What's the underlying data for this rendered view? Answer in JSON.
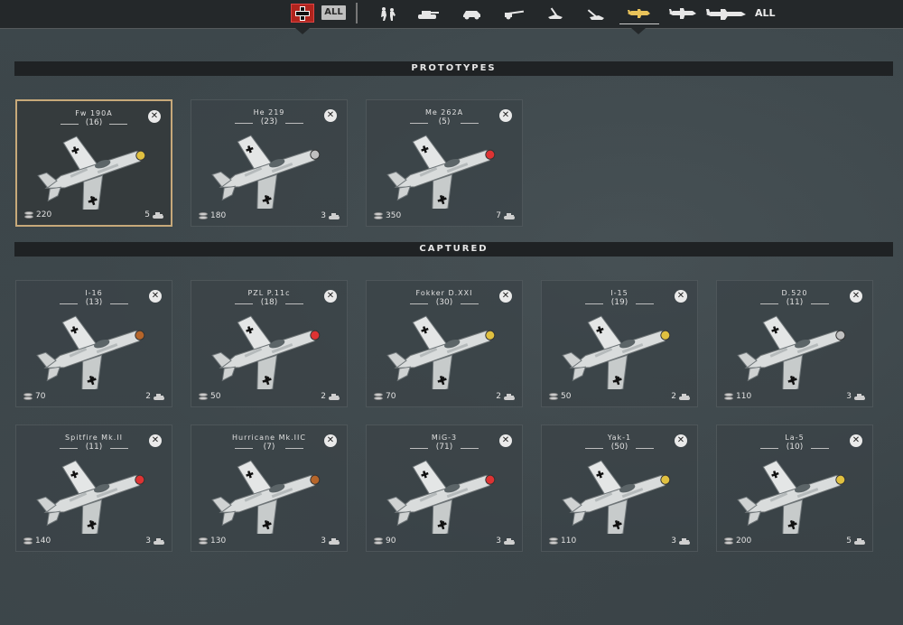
{
  "topbar": {
    "nation_icon": "german-cross-icon",
    "all_small_label": "ALL",
    "all_label": "ALL",
    "categories": [
      {
        "icon": "infantry-icon"
      },
      {
        "icon": "tank-icon"
      },
      {
        "icon": "armored-car-icon"
      },
      {
        "icon": "artillery-icon"
      },
      {
        "icon": "anti-tank-gun-icon"
      },
      {
        "icon": "anti-air-gun-icon"
      },
      {
        "icon": "fighter-plane-icon"
      },
      {
        "icon": "bomber-plane-icon"
      },
      {
        "icon": "heavy-bomber-icon"
      }
    ]
  },
  "sections": {
    "prototypes": "PROTOTYPES",
    "captured": "CAPTURED"
  },
  "prototypes": [
    {
      "name": "Fw 190A",
      "count": "(16)",
      "cost": "220",
      "requirement": "5",
      "selected": true
    },
    {
      "name": "He 219",
      "count": "(23)",
      "cost": "180",
      "requirement": "3"
    },
    {
      "name": "Me 262A",
      "count": "(5)",
      "cost": "350",
      "requirement": "7"
    }
  ],
  "captured_row1": [
    {
      "name": "I-16",
      "count": "(13)",
      "cost": "70",
      "requirement": "2"
    },
    {
      "name": "PZL P.11c",
      "count": "(18)",
      "cost": "50",
      "requirement": "2"
    },
    {
      "name": "Fokker D.XXI",
      "count": "(30)",
      "cost": "70",
      "requirement": "2"
    },
    {
      "name": "I-15",
      "count": "(19)",
      "cost": "50",
      "requirement": "2"
    },
    {
      "name": "D.520",
      "count": "(11)",
      "cost": "110",
      "requirement": "3"
    }
  ],
  "captured_row2": [
    {
      "name": "Spitfire Mk.II",
      "count": "(11)",
      "cost": "140",
      "requirement": "3"
    },
    {
      "name": "Hurricane Mk.IIC",
      "count": "(7)",
      "cost": "130",
      "requirement": "3"
    },
    {
      "name": "MiG-3",
      "count": "(71)",
      "cost": "90",
      "requirement": "3"
    },
    {
      "name": "Yak-1",
      "count": "(50)",
      "cost": "110",
      "requirement": "3"
    },
    {
      "name": "La-5",
      "count": "(10)",
      "cost": "200",
      "requirement": "5"
    }
  ],
  "colors": {
    "selected_border": "#c7a97a",
    "nation_red": "#b0241d",
    "panel_dark": "#1f2224"
  }
}
